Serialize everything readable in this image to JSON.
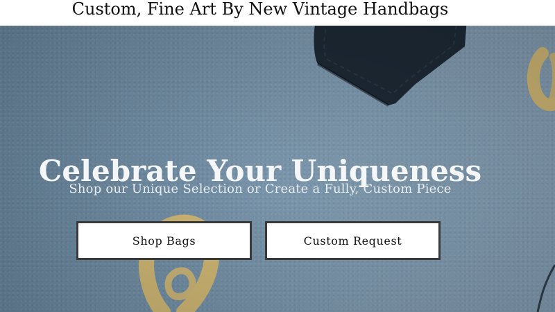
{
  "header": {
    "title": "Custom, Fine Art By New Vintage Handbags"
  },
  "hero": {
    "headline": "Celebrate Your Uniqueness",
    "subheadline": "Shop our Unique Selection or Create a Fully, Custom Piece",
    "buttons": [
      {
        "label": "Shop Bags"
      },
      {
        "label": "Custom Request"
      }
    ]
  },
  "colors": {
    "hero_blue": "#7a98b0",
    "button_border": "#3a3a3a",
    "gold": "#d9c07a",
    "leather_dark": "#1f2b38"
  }
}
